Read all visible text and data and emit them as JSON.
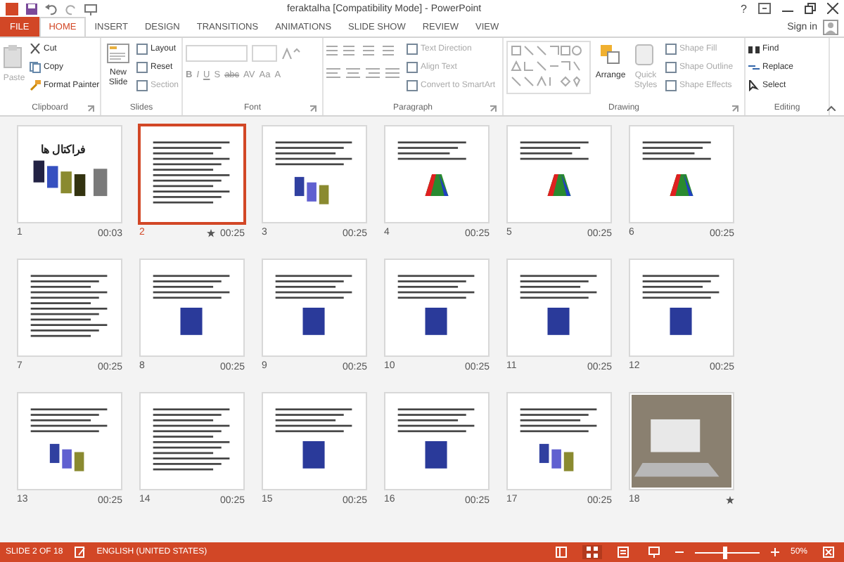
{
  "window": {
    "title": "feraktalha [Compatibility Mode] - PowerPoint",
    "sign_in": "Sign in",
    "help": "?"
  },
  "tabs": [
    {
      "label": "FILE",
      "kind": "file",
      "selected": false
    },
    {
      "label": "HOME",
      "kind": "tab",
      "selected": true
    },
    {
      "label": "INSERT",
      "kind": "tab",
      "selected": false
    },
    {
      "label": "DESIGN",
      "kind": "tab",
      "selected": false
    },
    {
      "label": "TRANSITIONS",
      "kind": "tab",
      "selected": false
    },
    {
      "label": "ANIMATIONS",
      "kind": "tab",
      "selected": false
    },
    {
      "label": "SLIDE SHOW",
      "kind": "tab",
      "selected": false
    },
    {
      "label": "REVIEW",
      "kind": "tab",
      "selected": false
    },
    {
      "label": "VIEW",
      "kind": "tab",
      "selected": false
    }
  ],
  "ribbon": {
    "clipboard": {
      "label": "Clipboard",
      "paste": {
        "label": "Paste",
        "disabled": true
      },
      "items": [
        {
          "label": "Cut",
          "disabled": false
        },
        {
          "label": "Copy",
          "disabled": false
        },
        {
          "label": "Format Painter",
          "disabled": false
        }
      ]
    },
    "slides": {
      "label": "Slides",
      "new_slide": {
        "label": "New Slide",
        "disabled": false
      },
      "items": [
        {
          "label": "Layout",
          "disabled": false
        },
        {
          "label": "Reset",
          "disabled": false
        },
        {
          "label": "Section",
          "disabled": true
        }
      ]
    },
    "font": {
      "label": "Font",
      "format_buttons": [
        "B",
        "I",
        "U",
        "S",
        "abc",
        "AV",
        "Aa",
        "A"
      ]
    },
    "paragraph": {
      "label": "Paragraph",
      "items": [
        {
          "label": "Text Direction",
          "disabled": true
        },
        {
          "label": "Align Text",
          "disabled": true
        },
        {
          "label": "Convert to SmartArt",
          "disabled": true
        }
      ]
    },
    "drawing": {
      "label": "Drawing",
      "arrange": {
        "label": "Arrange",
        "disabled": false
      },
      "quick_styles": {
        "label": "Quick Styles",
        "disabled": true
      },
      "items": [
        {
          "label": "Shape Fill",
          "disabled": true
        },
        {
          "label": "Shape Outline",
          "disabled": true
        },
        {
          "label": "Shape Effects",
          "disabled": true
        }
      ]
    },
    "editing": {
      "label": "Editing",
      "items": [
        {
          "label": "Find",
          "disabled": false
        },
        {
          "label": "Replace",
          "disabled": false
        },
        {
          "label": "Select",
          "disabled": false
        }
      ]
    }
  },
  "slides": [
    {
      "number": "1",
      "time": "00:03",
      "selected": false,
      "transition": false,
      "kind": "title",
      "title": "فراکتال ها"
    },
    {
      "number": "2",
      "time": "00:25",
      "selected": true,
      "transition": true,
      "kind": "text"
    },
    {
      "number": "3",
      "time": "00:25",
      "selected": false,
      "transition": false,
      "kind": "images"
    },
    {
      "number": "4",
      "time": "00:25",
      "selected": false,
      "transition": false,
      "kind": "shape"
    },
    {
      "number": "5",
      "time": "00:25",
      "selected": false,
      "transition": false,
      "kind": "shape"
    },
    {
      "number": "6",
      "time": "00:25",
      "selected": false,
      "transition": false,
      "kind": "shape"
    },
    {
      "number": "7",
      "time": "00:25",
      "selected": false,
      "transition": false,
      "kind": "text"
    },
    {
      "number": "8",
      "time": "00:25",
      "selected": false,
      "transition": false,
      "kind": "image"
    },
    {
      "number": "9",
      "time": "00:25",
      "selected": false,
      "transition": false,
      "kind": "image"
    },
    {
      "number": "10",
      "time": "00:25",
      "selected": false,
      "transition": false,
      "kind": "image"
    },
    {
      "number": "11",
      "time": "00:25",
      "selected": false,
      "transition": false,
      "kind": "image"
    },
    {
      "number": "12",
      "time": "00:25",
      "selected": false,
      "transition": false,
      "kind": "image"
    },
    {
      "number": "13",
      "time": "00:25",
      "selected": false,
      "transition": false,
      "kind": "images"
    },
    {
      "number": "14",
      "time": "00:25",
      "selected": false,
      "transition": false,
      "kind": "text"
    },
    {
      "number": "15",
      "time": "00:25",
      "selected": false,
      "transition": false,
      "kind": "image"
    },
    {
      "number": "16",
      "time": "00:25",
      "selected": false,
      "transition": false,
      "kind": "image"
    },
    {
      "number": "17",
      "time": "00:25",
      "selected": false,
      "transition": false,
      "kind": "images"
    },
    {
      "number": "18",
      "selected": false,
      "transition": true,
      "kind": "photo"
    }
  ],
  "status_bar": {
    "slide_info": "SLIDE 2 OF 18",
    "language": "ENGLISH (UNITED STATES)",
    "zoom": {
      "level": 0.45
    },
    "zoom_percent": "50%"
  }
}
